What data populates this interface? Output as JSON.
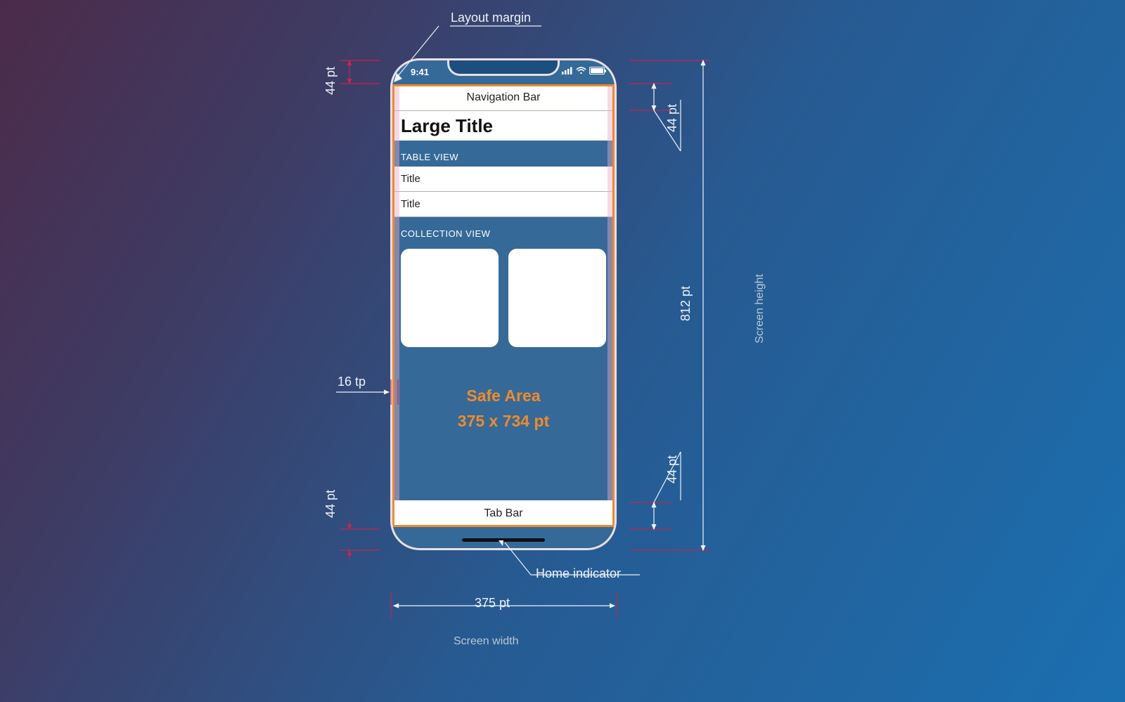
{
  "labels": {
    "layout_margin": "Layout margin",
    "home_indicator": "Home indicator",
    "screen_width": "Screen width",
    "screen_height": "Screen height"
  },
  "dimensions": {
    "status_bar_height": "44 pt",
    "nav_bar_height": "44 pt",
    "tab_bar_height": "44 pt",
    "bottom_inset": "44 pt",
    "layout_margin": "16 tp",
    "screen_width": "375 pt",
    "screen_height": "812 pt"
  },
  "phone": {
    "time": "9:41",
    "nav_bar": "Navigation Bar",
    "large_title": "Large Title",
    "table_header": "TABLE VIEW",
    "table_rows": [
      "Title",
      "Title"
    ],
    "collection_header": "COLLECTION VIEW",
    "tab_bar": "Tab Bar",
    "safe_area": {
      "line1": "Safe Area",
      "line2": "375 x 734 pt"
    }
  }
}
